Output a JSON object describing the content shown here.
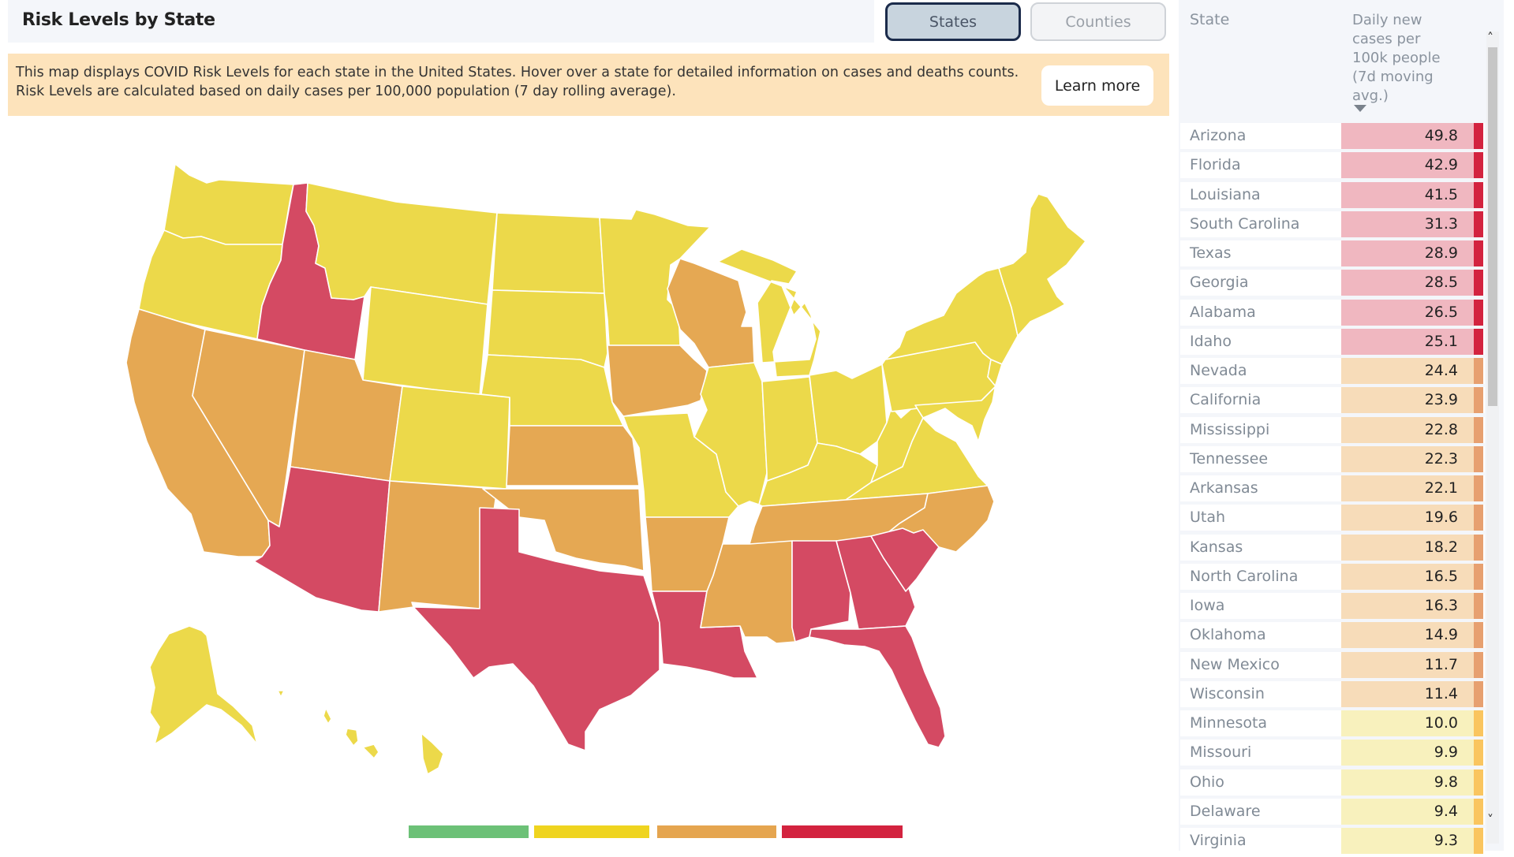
{
  "header": {
    "title": "Risk Levels by State",
    "toggle": [
      {
        "label": "States",
        "active": true
      },
      {
        "label": "Counties",
        "active": false
      }
    ]
  },
  "banner": {
    "text": "This map displays COVID Risk Levels for each state in the United States. Hover over a state for detailed information on cases and deaths counts. Risk Levels are calculated based on daily cases per 100,000 population (7 day rolling average).",
    "button_label": "Learn more"
  },
  "colors": {
    "low": "#6cc177",
    "medium": "#ecd94a",
    "high": "#e5a853",
    "critical": "#d44a63",
    "legend_critical": "#d3233f",
    "legend_medium": "#efd41f",
    "legend_high": "#e5a54f",
    "row_critical_bg": "#f0b7c0",
    "row_high_bg": "#f7dcb9",
    "row_medium_bg": "#f8f1bd",
    "bar_critical": "#d3233f",
    "bar_high": "#e7a070",
    "bar_medium": "#fac55f"
  },
  "map": {
    "state_levels": {
      "Washington": "medium",
      "Oregon": "medium",
      "California": "high",
      "Nevada": "high",
      "Idaho": "critical",
      "Montana": "medium",
      "Wyoming": "medium",
      "Utah": "high",
      "Arizona": "critical",
      "Colorado": "medium",
      "New Mexico": "high",
      "North Dakota": "medium",
      "South Dakota": "medium",
      "Nebraska": "medium",
      "Kansas": "high",
      "Oklahoma": "high",
      "Texas": "critical",
      "Minnesota": "medium",
      "Iowa": "high",
      "Missouri": "medium",
      "Arkansas": "high",
      "Louisiana": "critical",
      "Wisconsin": "high",
      "Illinois": "medium",
      "Michigan": "medium",
      "Indiana": "medium",
      "Ohio": "medium",
      "Kentucky": "medium",
      "Tennessee": "high",
      "Mississippi": "high",
      "Alabama": "critical",
      "Georgia": "critical",
      "Florida": "critical",
      "South Carolina": "critical",
      "North Carolina": "high",
      "Virginia": "medium",
      "West Virginia": "medium",
      "Pennsylvania": "medium",
      "New York": "medium",
      "New England": "medium",
      "Alaska": "medium",
      "Hawaii": "medium"
    }
  },
  "legend": [
    {
      "level": "low"
    },
    {
      "level": "medium"
    },
    {
      "level": "high"
    },
    {
      "level": "critical"
    }
  ],
  "table": {
    "columns": [
      "State",
      "Daily new cases per 100k people (7d moving avg.)"
    ],
    "sort": "descending",
    "rows": [
      {
        "state": "Arizona",
        "value": "49.8",
        "level": "critical"
      },
      {
        "state": "Florida",
        "value": "42.9",
        "level": "critical"
      },
      {
        "state": "Louisiana",
        "value": "41.5",
        "level": "critical"
      },
      {
        "state": "South Carolina",
        "value": "31.3",
        "level": "critical"
      },
      {
        "state": "Texas",
        "value": "28.9",
        "level": "critical"
      },
      {
        "state": "Georgia",
        "value": "28.5",
        "level": "critical"
      },
      {
        "state": "Alabama",
        "value": "26.5",
        "level": "critical"
      },
      {
        "state": "Idaho",
        "value": "25.1",
        "level": "critical"
      },
      {
        "state": "Nevada",
        "value": "24.4",
        "level": "high"
      },
      {
        "state": "California",
        "value": "23.9",
        "level": "high"
      },
      {
        "state": "Mississippi",
        "value": "22.8",
        "level": "high"
      },
      {
        "state": "Tennessee",
        "value": "22.3",
        "level": "high"
      },
      {
        "state": "Arkansas",
        "value": "22.1",
        "level": "high"
      },
      {
        "state": "Utah",
        "value": "19.6",
        "level": "high"
      },
      {
        "state": "Kansas",
        "value": "18.2",
        "level": "high"
      },
      {
        "state": "North Carolina",
        "value": "16.5",
        "level": "high"
      },
      {
        "state": "Iowa",
        "value": "16.3",
        "level": "high"
      },
      {
        "state": "Oklahoma",
        "value": "14.9",
        "level": "high"
      },
      {
        "state": "New Mexico",
        "value": "11.7",
        "level": "high"
      },
      {
        "state": "Wisconsin",
        "value": "11.4",
        "level": "high"
      },
      {
        "state": "Minnesota",
        "value": "10.0",
        "level": "medium"
      },
      {
        "state": "Missouri",
        "value": "9.9",
        "level": "medium"
      },
      {
        "state": "Ohio",
        "value": "9.8",
        "level": "medium"
      },
      {
        "state": "Delaware",
        "value": "9.4",
        "level": "medium"
      },
      {
        "state": "Virginia",
        "value": "9.3",
        "level": "medium"
      }
    ]
  },
  "scrollbar": {
    "up_icon": "˄",
    "down_icon": "˅"
  }
}
